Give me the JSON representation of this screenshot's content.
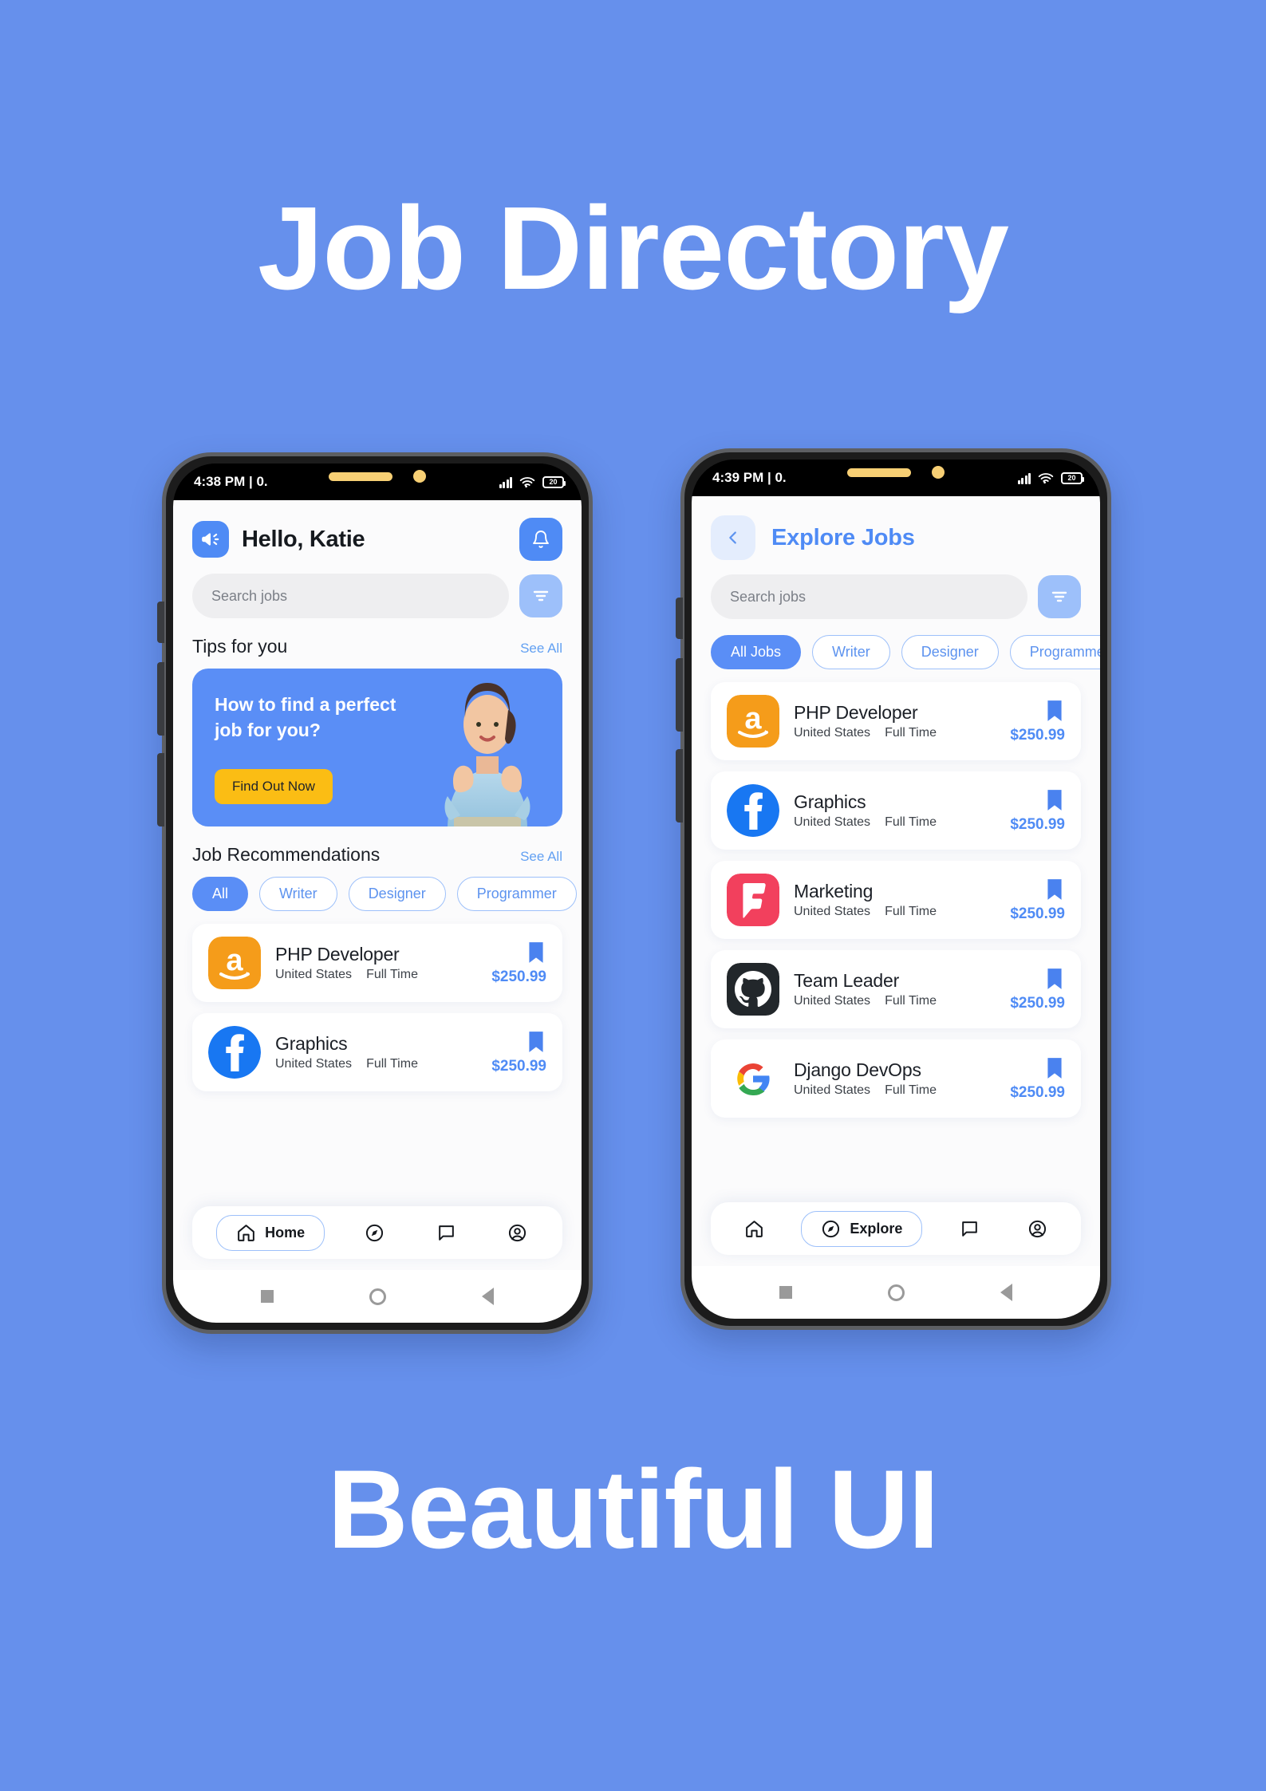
{
  "poster": {
    "title_top": "Job Directory",
    "title_bottom": "Beautiful UI",
    "background_color": "#6690ec",
    "accent_color": "#4f8bf5",
    "cta_color": "#fbbd14"
  },
  "phone_home": {
    "status": {
      "time": "4:38 PM | 0.",
      "battery": "20"
    },
    "header": {
      "greeting": "Hello, Katie",
      "logo_icon": "megaphone-icon",
      "bell_icon": "bell-icon"
    },
    "search": {
      "placeholder": "Search jobs",
      "value": "",
      "filter_icon": "filter-icon"
    },
    "tips": {
      "title": "Tips for you",
      "see_all": "See All"
    },
    "banner": {
      "headline": "How to find a perfect job for you?",
      "cta": "Find Out Now"
    },
    "recommendations": {
      "title": "Job Recommendations",
      "see_all": "See All"
    },
    "chips": [
      {
        "label": "All",
        "active": true
      },
      {
        "label": "Writer",
        "active": false
      },
      {
        "label": "Designer",
        "active": false
      },
      {
        "label": "Programmer",
        "active": false
      }
    ],
    "jobs": [
      {
        "title": "PHP Developer",
        "location": "United States",
        "type": "Full Time",
        "price": "$250.99",
        "logo": "amazon-logo"
      },
      {
        "title": "Graphics",
        "location": "United States",
        "type": "Full Time",
        "price": "$250.99",
        "logo": "facebook-logo"
      }
    ],
    "nav": [
      {
        "label": "Home",
        "icon": "home-icon",
        "active": true
      },
      {
        "label": "",
        "icon": "compass-icon",
        "active": false
      },
      {
        "label": "",
        "icon": "chat-icon",
        "active": false
      },
      {
        "label": "",
        "icon": "profile-icon",
        "active": false
      }
    ]
  },
  "phone_explore": {
    "status": {
      "time": "4:39 PM | 0.",
      "battery": "20"
    },
    "header": {
      "title": "Explore Jobs",
      "back_icon": "chevron-left-icon"
    },
    "search": {
      "placeholder": "Search jobs",
      "value": "",
      "filter_icon": "filter-icon"
    },
    "chips": [
      {
        "label": "All Jobs",
        "active": true
      },
      {
        "label": "Writer",
        "active": false
      },
      {
        "label": "Designer",
        "active": false
      },
      {
        "label": "Programmer",
        "active": false
      }
    ],
    "jobs": [
      {
        "title": "PHP Developer",
        "location": "United States",
        "type": "Full Time",
        "price": "$250.99",
        "logo": "amazon-logo"
      },
      {
        "title": "Graphics",
        "location": "United States",
        "type": "Full Time",
        "price": "$250.99",
        "logo": "facebook-logo"
      },
      {
        "title": "Marketing",
        "location": "United States",
        "type": "Full Time",
        "price": "$250.99",
        "logo": "foursquare-logo"
      },
      {
        "title": "Team Leader",
        "location": "United States",
        "type": "Full Time",
        "price": "$250.99",
        "logo": "github-logo"
      },
      {
        "title": "Django DevOps",
        "location": "United States",
        "type": "Full Time",
        "price": "$250.99",
        "logo": "google-logo"
      }
    ],
    "nav": [
      {
        "label": "",
        "icon": "home-icon",
        "active": false
      },
      {
        "label": "Explore",
        "icon": "compass-icon",
        "active": true
      },
      {
        "label": "",
        "icon": "chat-icon",
        "active": false
      },
      {
        "label": "",
        "icon": "profile-icon",
        "active": false
      }
    ]
  },
  "softkeys": {
    "recents": "recents-icon",
    "home": "home-circle-icon",
    "back": "back-triangle-icon"
  }
}
